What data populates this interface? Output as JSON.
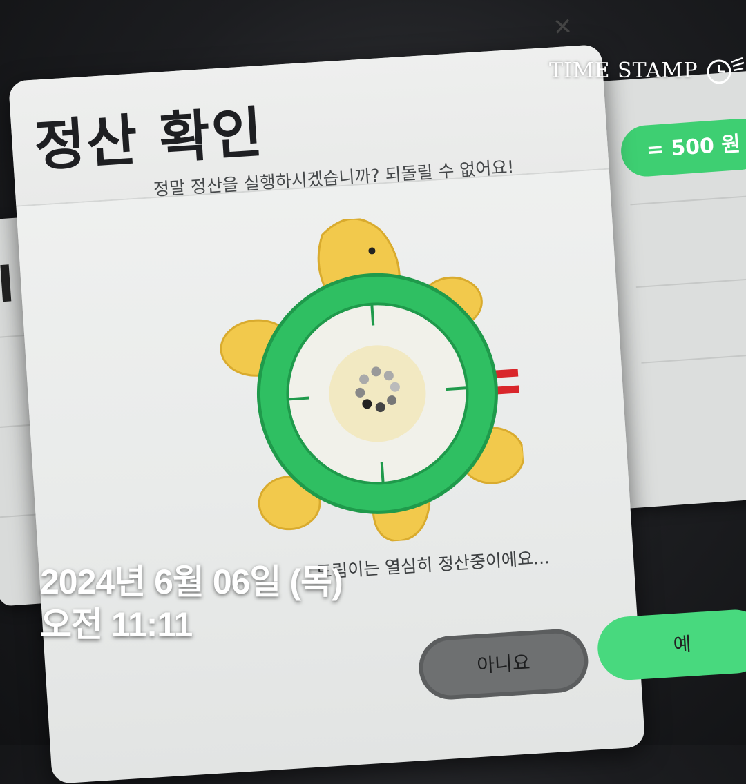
{
  "background": {
    "right_card_badge": "= 500 원",
    "left_card_fragment": "l 정"
  },
  "dialog": {
    "title": "정산 확인",
    "question": "정말 정산을 실행하시겠습니까? 되돌릴 수 없어요!",
    "status": "드림이는 열심히 정산중이에요...",
    "close_icon": "close-icon",
    "buttons": {
      "no_label": "아니요",
      "yes_label": "예"
    },
    "symbols": {
      "plus": "+",
      "equals": "=",
      "asterisk": "*"
    }
  },
  "overlay": {
    "watermark": "TIME STAMP",
    "date_line": "2024년 6월 06일 (목)",
    "time_line": "오전 11:11"
  },
  "colors": {
    "accent_green": "#48d97e",
    "turtle_shell": "#2fbf62",
    "turtle_body": "#f2c94c",
    "symbol_red": "#d9262b",
    "button_grey": "#6e7071"
  }
}
